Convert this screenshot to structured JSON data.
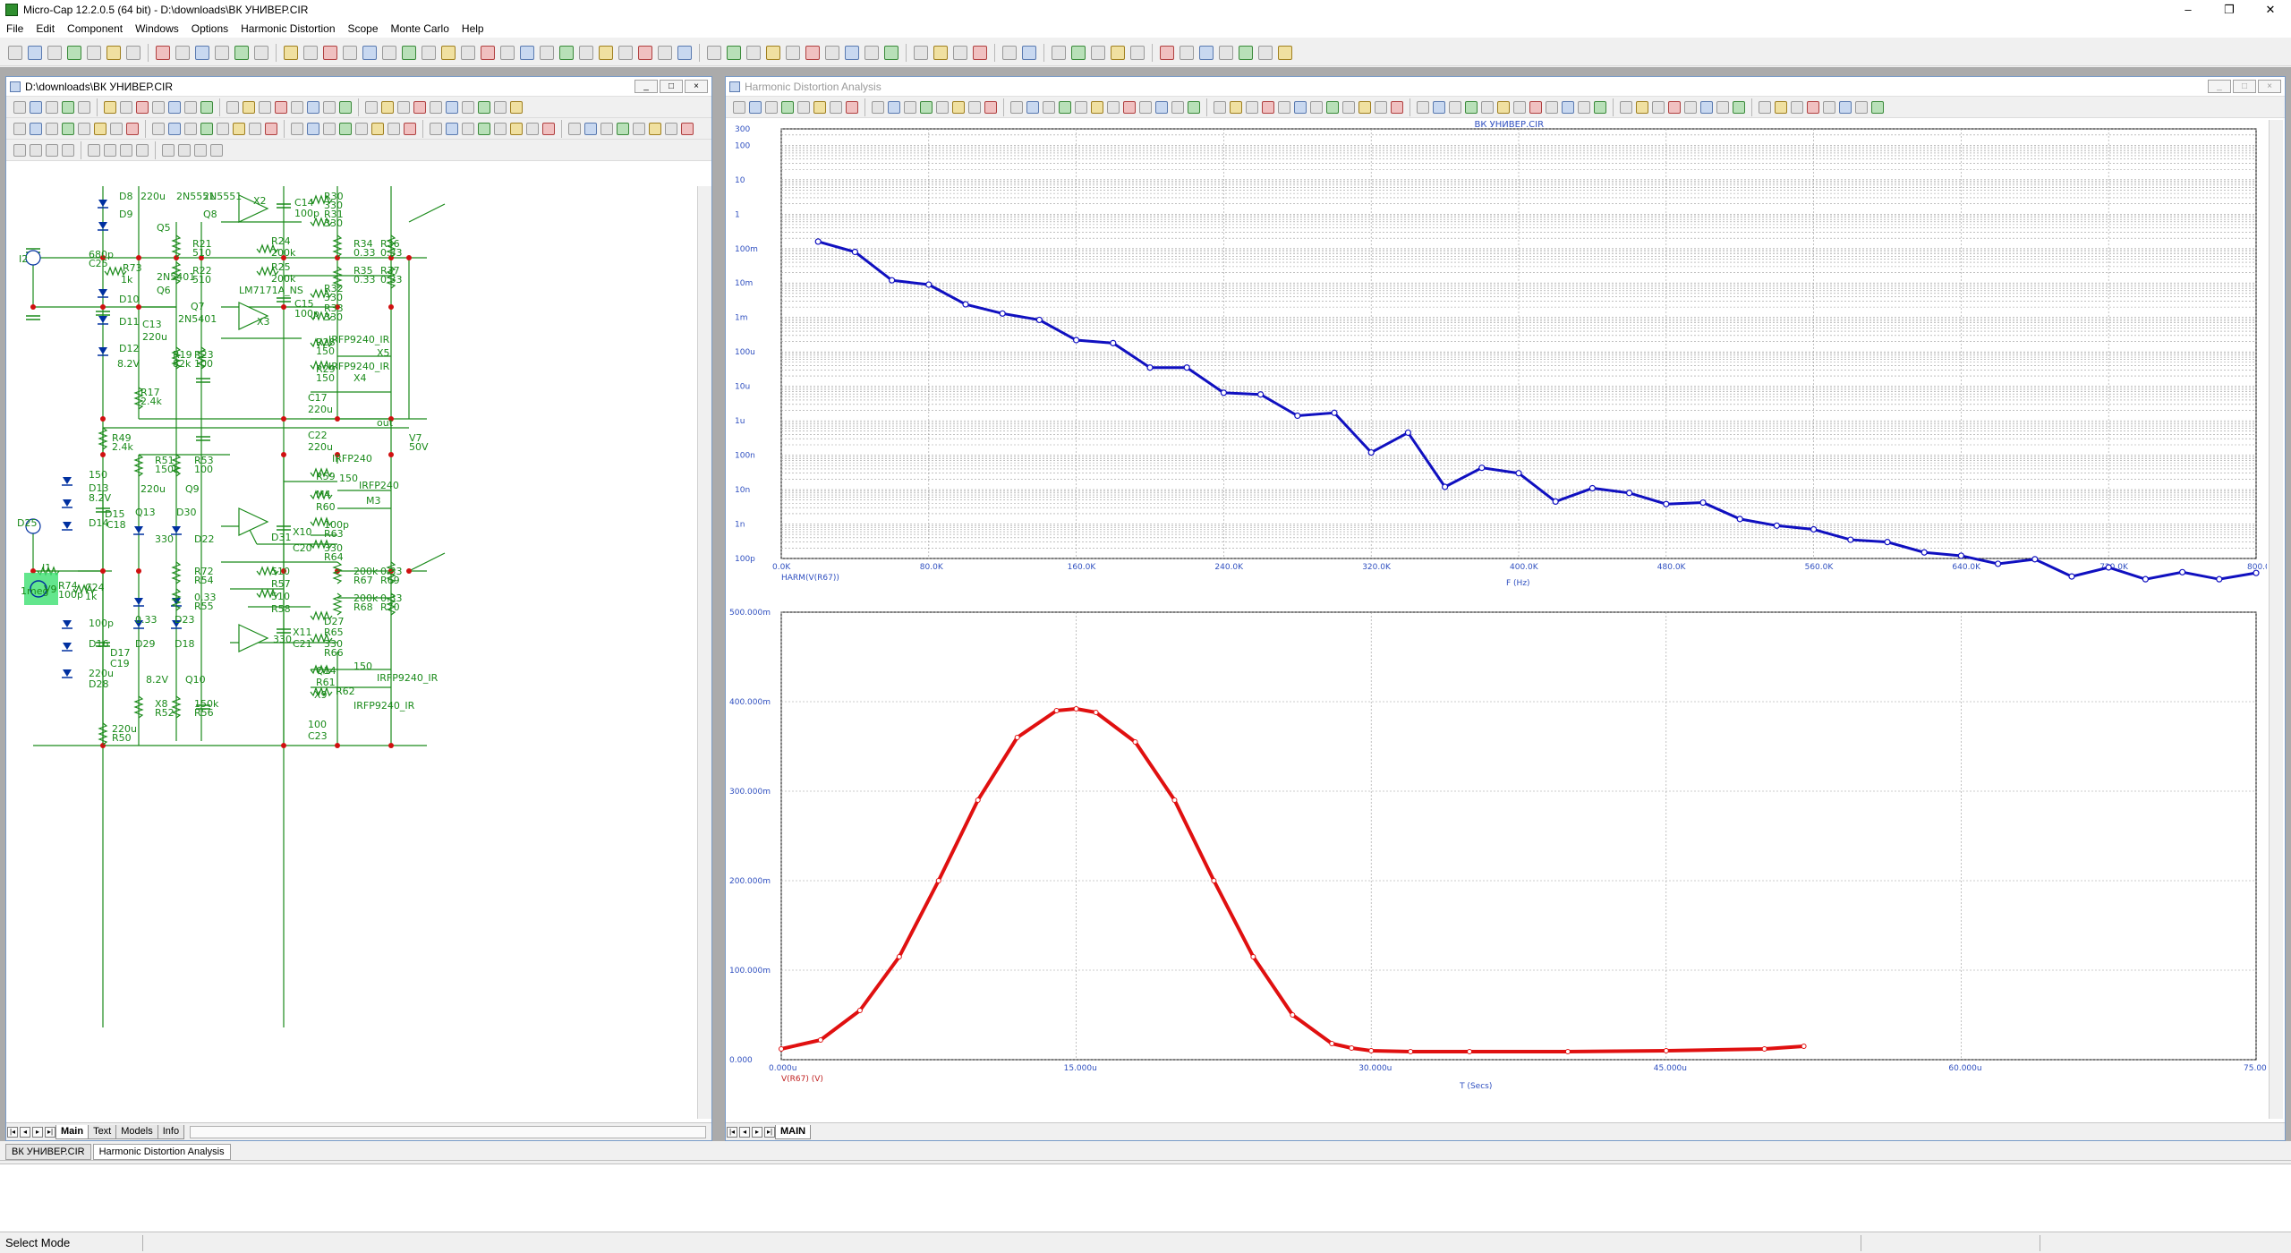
{
  "app": {
    "title": "Micro-Cap 12.2.0.5 (64 bit) - D:\\downloads\\ВК УНИВЕР.CIR",
    "window_controls": {
      "minimize": "–",
      "maximize": "❐",
      "close": "✕"
    }
  },
  "menu": [
    "File",
    "Edit",
    "Component",
    "Windows",
    "Options",
    "Harmonic Distortion",
    "Scope",
    "Monte Carlo",
    "Help"
  ],
  "schematic_window": {
    "title": "D:\\downloads\\ВК УНИВЕР.CIR",
    "tabs": [
      "Main",
      "Text",
      "Models",
      "Info"
    ],
    "active_tab": "Main",
    "labels": {
      "top": [
        "D8",
        "220u",
        "2N5551",
        "2N5551",
        "Q8",
        "Q5",
        "D9",
        "X2",
        "C14",
        "100p",
        "R30",
        "330",
        "R31",
        "330",
        "R24",
        "200k",
        "R34",
        "0.33",
        "R36",
        "0.33",
        "R21",
        "510",
        "R22",
        "510",
        "R35",
        "0.33",
        "R37",
        "0.33",
        "R25",
        "200k",
        "2N5401",
        "Q6",
        "Q7",
        "2N5401",
        "LM7171A_NS",
        "C15",
        "100p",
        "R32",
        "330",
        "R33",
        "330",
        "X3",
        "D10",
        "D11",
        "C13",
        "220u",
        "D12",
        "8.2V",
        "R19",
        "82k",
        "R23",
        "100",
        "R28",
        "150",
        "R29",
        "150",
        "IRFP9240_IR",
        "X5",
        "IRFP9240_IR",
        "X4",
        "R17",
        "2.4k",
        "C17",
        "220u",
        "I2",
        "680p",
        "C25",
        "R73",
        "1k"
      ],
      "bottom": [
        "out",
        "V7",
        "50V",
        "R49",
        "2.4k",
        "C22",
        "220u",
        "R51",
        "150k",
        "R53",
        "100",
        "IRFP240",
        "IRFP240",
        "R59",
        "150",
        "M3",
        "M4",
        "R60",
        "150",
        "D13",
        "8.2V",
        "D14",
        "D15",
        "C18",
        "220u",
        "Q9",
        "Q13",
        "D30",
        "D31",
        "X10",
        "C20",
        "100p",
        "R63",
        "330",
        "R64",
        "330",
        "D22",
        "D25",
        "I1",
        "1meg",
        "V9",
        "R74",
        "100p",
        "C24",
        "1k",
        "R72",
        "R54",
        "510",
        "R57",
        "200k",
        "R67",
        "0.33",
        "R69",
        "0.33",
        "R55",
        "510",
        "R58",
        "200k",
        "R68",
        "0.33",
        "R70",
        "0.33",
        "D23",
        "D27",
        "R65",
        "330",
        "R66",
        "330",
        "X11",
        "C21",
        "100p",
        "D16",
        "D17",
        "C19",
        "220u",
        "D28",
        "D29",
        "D18",
        "8.2V",
        "Q10",
        "Q14",
        "R61",
        "150",
        "IRFP9240_IR",
        "X9",
        "R62",
        "IRFP9240_IR",
        "X8",
        "R52",
        "150k",
        "R56",
        "100",
        "C23",
        "220u",
        "R50",
        "2.4k"
      ]
    }
  },
  "analysis_window": {
    "title": "Harmonic Distortion Analysis",
    "tabs": [
      "MAIN"
    ],
    "active_tab": "MAIN"
  },
  "chart_data": [
    {
      "type": "line",
      "title": "ВК УНИВЕР.CIR",
      "series_label": "HARM(V(R67))",
      "xlabel": "F (Hz)",
      "ylabel": "",
      "x_unit": "Hz",
      "xlim": [
        0,
        800000
      ],
      "ylim_log": [
        1e-10,
        300
      ],
      "log_y": true,
      "grid": true,
      "color": "#1010c0",
      "x_ticks": [
        "0.0K",
        "80.0K",
        "160.0K",
        "240.0K",
        "320.0K",
        "400.0K",
        "480.0K",
        "560.0K",
        "640.0K",
        "720.0K",
        "800.0K"
      ],
      "y_ticks": [
        "300",
        "100",
        "10",
        "1",
        "100m",
        "10m",
        "1m",
        "100u",
        "10u",
        "1u",
        "100n",
        "10n",
        "1n",
        "100p"
      ],
      "x": [
        20000,
        40000,
        60000,
        80000,
        100000,
        120000,
        140000,
        160000,
        180000,
        200000,
        220000,
        240000,
        260000,
        280000,
        300000,
        320000,
        340000,
        360000,
        380000,
        400000,
        420000,
        440000,
        460000,
        480000,
        500000,
        520000,
        540000,
        560000,
        580000,
        600000,
        620000,
        640000,
        660000,
        680000,
        700000,
        720000,
        740000,
        760000,
        780000,
        800000
      ],
      "values": [
        0.16,
        0.08,
        0.012,
        0.009,
        0.0024,
        0.0013,
        0.00085,
        0.00022,
        0.00018,
        3.5e-05,
        3.5e-05,
        6.5e-06,
        5.8e-06,
        1.4e-06,
        1.7e-06,
        1.2e-07,
        4.5e-07,
        1.2e-08,
        4.3e-08,
        3e-08,
        4.5e-09,
        1.1e-08,
        8e-09,
        3.8e-09,
        4.2e-09,
        1.4e-09,
        9e-10,
        7e-10,
        3.5e-10,
        3e-10,
        1.5e-10,
        1.2e-10,
        7e-11,
        9.5e-11,
        3e-11,
        5.5e-11,
        2.5e-11,
        4e-11,
        2.5e-11,
        3.8e-11
      ]
    },
    {
      "type": "line",
      "series_label": "V(R67) (V)",
      "xlabel": "T (Secs)",
      "ylabel": "",
      "xlim": [
        0,
        7.5e-05
      ],
      "ylim": [
        0,
        0.5
      ],
      "grid": true,
      "color": "#e01010",
      "x_ticks": [
        "0.000u",
        "15.000u",
        "30.000u",
        "45.000u",
        "60.000u",
        "75.000u"
      ],
      "y_ticks": [
        "500.000m",
        "400.000m",
        "300.000m",
        "200.000m",
        "100.000m",
        "0.000"
      ],
      "x_us": [
        0,
        2,
        4,
        6,
        8,
        10,
        12,
        14,
        15,
        16,
        18,
        20,
        22,
        24,
        26,
        28,
        29,
        30,
        32,
        35,
        40,
        45,
        50,
        52
      ],
      "values": [
        0.012,
        0.022,
        0.055,
        0.115,
        0.2,
        0.29,
        0.36,
        0.39,
        0.392,
        0.388,
        0.355,
        0.29,
        0.2,
        0.115,
        0.05,
        0.018,
        0.013,
        0.01,
        0.009,
        0.009,
        0.009,
        0.01,
        0.012,
        0.015
      ]
    }
  ],
  "doc_tabs": [
    "ВК УНИВЕР.CIR",
    "Harmonic Distortion Analysis"
  ],
  "status": {
    "mode": "Select Mode"
  }
}
